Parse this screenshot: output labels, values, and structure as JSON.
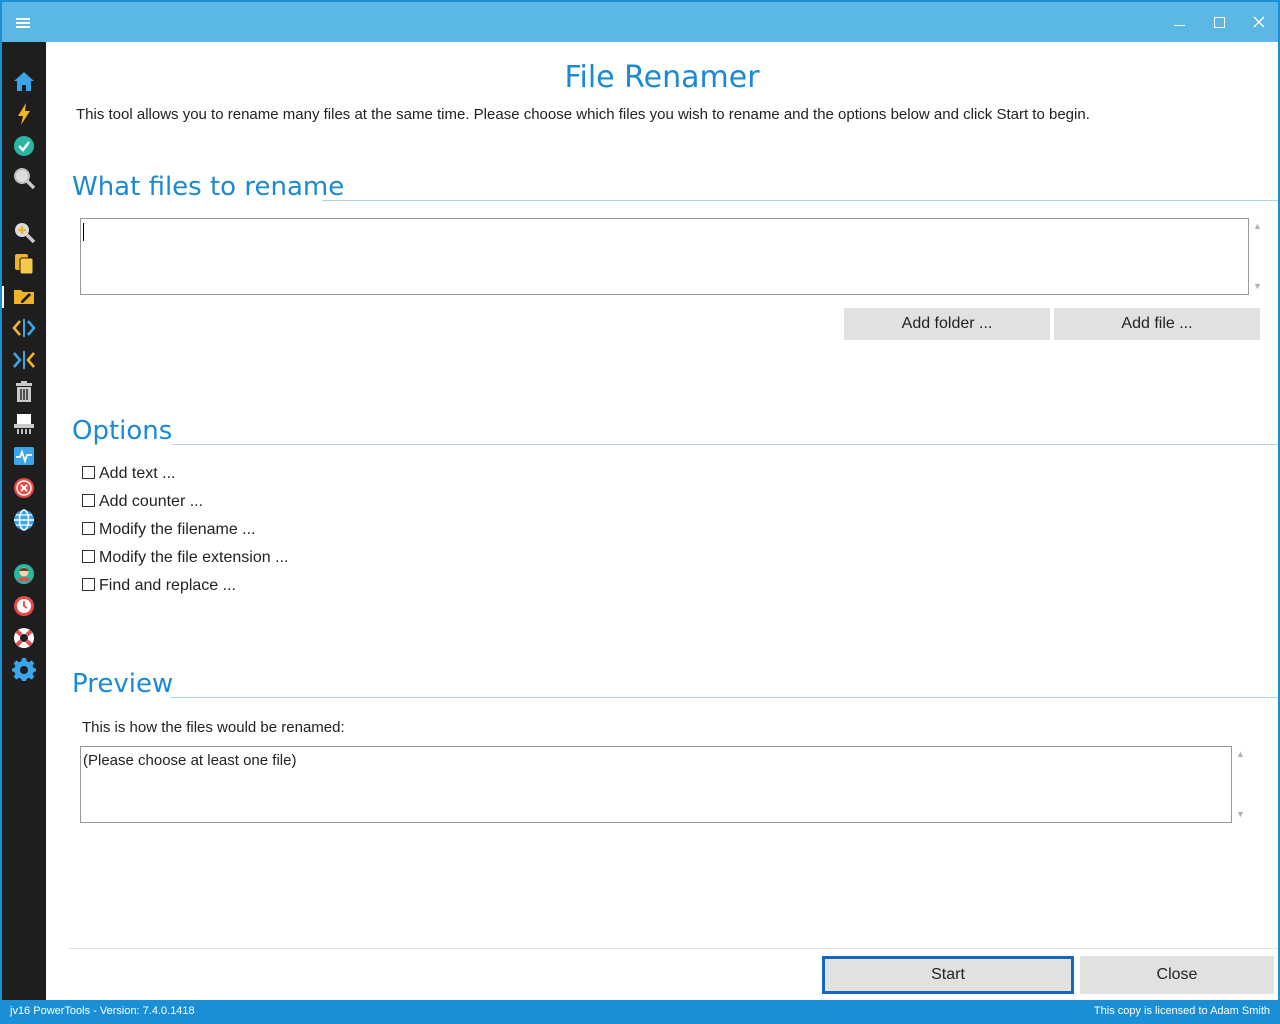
{
  "window": {
    "app_name": "jv16 PowerTools"
  },
  "sidebar": {
    "items": [
      {
        "name": "home",
        "icon": "home-icon",
        "color": "#3aa5e8"
      },
      {
        "name": "quick",
        "icon": "lightning-icon",
        "color": "#f0b429"
      },
      {
        "name": "check",
        "icon": "checkmark-icon",
        "color": "#2bb6a3"
      },
      {
        "name": "search",
        "icon": "magnifier-icon",
        "color": "#c9c9c9"
      },
      {
        "name": "zoom",
        "icon": "zoom-in-icon",
        "color": "#f0b429"
      },
      {
        "name": "duplicate",
        "icon": "copy-files-icon",
        "color": "#f0b429"
      },
      {
        "name": "file-renamer",
        "icon": "folder-edit-icon",
        "color": "#f0b429"
      },
      {
        "name": "split",
        "icon": "split-arrows-icon",
        "color": "#3aa5e8"
      },
      {
        "name": "join",
        "icon": "merge-arrows-icon",
        "color": "#3aa5e8"
      },
      {
        "name": "delete",
        "icon": "trash-icon",
        "color": "#c9c9c9"
      },
      {
        "name": "shredder",
        "icon": "shredder-icon",
        "color": "#ffffff"
      },
      {
        "name": "monitor",
        "icon": "activity-monitor-icon",
        "color": "#3aa5e8"
      },
      {
        "name": "block",
        "icon": "close-circle-icon",
        "color": "#e84a4a"
      },
      {
        "name": "internet",
        "icon": "globe-icon",
        "color": "#3aa5e8"
      },
      {
        "name": "profile",
        "icon": "user-avatar-icon",
        "color": "#2bb6a3"
      },
      {
        "name": "history",
        "icon": "clock-icon",
        "color": "#e84a4a"
      },
      {
        "name": "help",
        "icon": "lifebuoy-icon",
        "color": "#e84a4a"
      },
      {
        "name": "settings",
        "icon": "gear-icon",
        "color": "#3aa5e8"
      }
    ]
  },
  "main": {
    "title": "File Renamer",
    "description": "This tool allows you to rename many files at the same time. Please choose which files you wish to rename and the options below and click Start to begin.",
    "files_section": {
      "header": "What files to rename",
      "files_input_value": "",
      "add_folder_label": "Add folder ...",
      "add_file_label": "Add file ..."
    },
    "options_section": {
      "header": "Options",
      "options": [
        {
          "label": "Add text ...",
          "checked": false
        },
        {
          "label": "Add counter ...",
          "checked": false
        },
        {
          "label": "Modify the filename ...",
          "checked": false
        },
        {
          "label": "Modify the file extension ...",
          "checked": false
        },
        {
          "label": "Find and replace ...",
          "checked": false
        }
      ]
    },
    "preview_section": {
      "header": "Preview",
      "label": "This is how the files would be renamed:",
      "preview_text": "(Please choose at least one file)"
    },
    "start_label": "Start",
    "close_label": "Close"
  },
  "statusbar": {
    "version_text": "jv16 PowerTools - Version: 7.4.0.1418",
    "license_text": "This copy is licensed to Adam Smith"
  },
  "colors": {
    "accent": "#1a8ad4",
    "titlebar": "#5bb8e5",
    "statusbar": "#1b8fd6",
    "sidebar": "#1e1e1e",
    "primary_button_border": "#1468c2"
  }
}
